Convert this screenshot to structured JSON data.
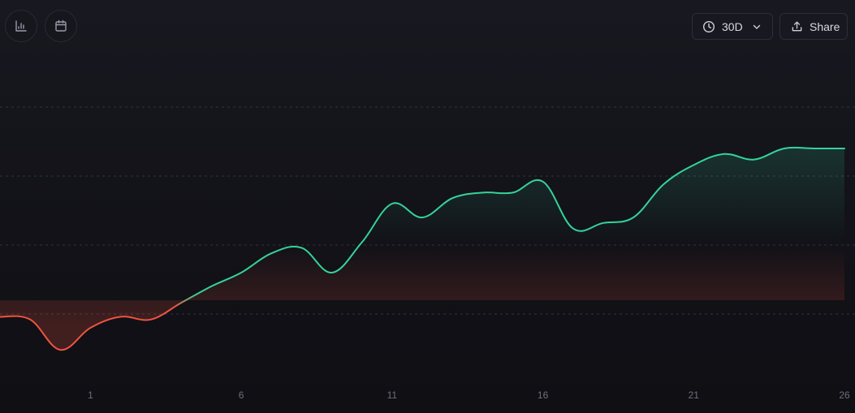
{
  "toolbar": {
    "left_icons": [
      "bar-chart-icon",
      "calendar-icon"
    ],
    "range_button": {
      "icon": "clock-icon",
      "label": "30D",
      "chevron": "chevron-down-icon"
    },
    "share_button": {
      "icon": "share-icon",
      "label": "Share"
    }
  },
  "colors": {
    "positive": "#34d399",
    "negative": "#f0533f",
    "grid": "#33333f",
    "tick_text": "#6f6f7d"
  },
  "chart_data": {
    "type": "line",
    "title": "",
    "xlabel": "",
    "ylabel": "",
    "xlim": [
      -2,
      26
    ],
    "ylim": [
      -3,
      7
    ],
    "grid": true,
    "legend": "none",
    "baseline": 0,
    "x_ticks": [
      1,
      6,
      11,
      16,
      21,
      26
    ],
    "x_tick_labels": [
      "1",
      "6",
      "11",
      "16",
      "21",
      "26"
    ],
    "series": [
      {
        "x": [
          -2,
          -1,
          0,
          1,
          2,
          3,
          4,
          5,
          6,
          7,
          8,
          9,
          10,
          11,
          12,
          13,
          14,
          15,
          16,
          17,
          18,
          19,
          20,
          21,
          22,
          23,
          24,
          25,
          26
        ],
        "y": [
          -0.6,
          -0.7,
          -1.8,
          -1.0,
          -0.6,
          -0.7,
          -0.1,
          0.5,
          1.0,
          1.7,
          1.9,
          1.0,
          2.1,
          3.5,
          3.0,
          3.7,
          3.9,
          3.9,
          4.3,
          2.6,
          2.8,
          3.0,
          4.2,
          4.9,
          5.3,
          5.1,
          5.5,
          5.5,
          5.5
        ]
      }
    ]
  }
}
